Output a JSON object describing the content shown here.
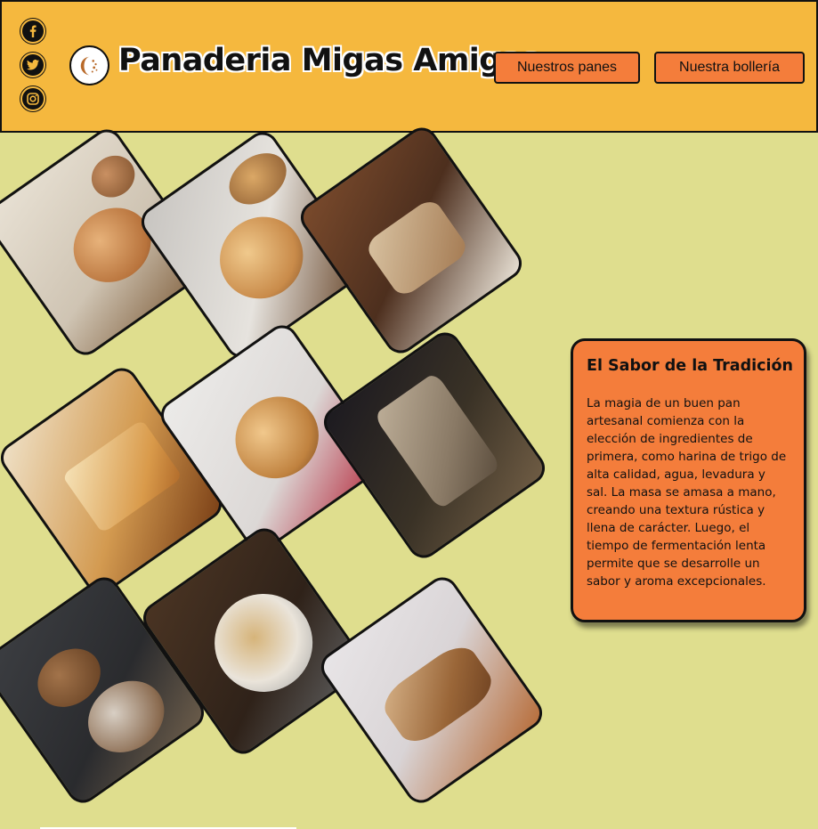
{
  "header": {
    "brand": "Panaderia Migas Amigas",
    "logo_icon": "bread-logo-icon",
    "nav": [
      {
        "label": "Nuestros panes"
      },
      {
        "label": "Nuestra bollería"
      }
    ],
    "social": [
      {
        "icon": "facebook-icon"
      },
      {
        "icon": "twitter-icon"
      },
      {
        "icon": "instagram-icon"
      }
    ]
  },
  "gallery": {
    "items": [
      {
        "subject": "round rustic loaf on linen"
      },
      {
        "subject": "cut sourdough loaf on striped cloth"
      },
      {
        "subject": "sliced bread on board"
      },
      {
        "subject": "sliced white sandwich loaf"
      },
      {
        "subject": "scored boule on red striped towel"
      },
      {
        "subject": "sliced seeded rye loaf"
      },
      {
        "subject": "multigrain loaves with wheat"
      },
      {
        "subject": "floured country loaf on dark wood"
      },
      {
        "subject": "sliced loaf on cutting board"
      }
    ]
  },
  "card": {
    "title": "El Sabor de la Tradición",
    "text": "La magia de un buen pan artesanal comienza con la elección de ingredientes de primera, como harina de trigo de alta calidad, agua, levadura y sal. La masa se amasa a mano, creando una textura rústica y llena de carácter. Luego, el tiempo de fermentación lenta permite que se desarrolle un sabor y aroma excepcionales."
  },
  "colors": {
    "header_bg": "#f5b83e",
    "page_bg": "#dfde8e",
    "accent": "#f47d3b",
    "border": "#111111"
  }
}
